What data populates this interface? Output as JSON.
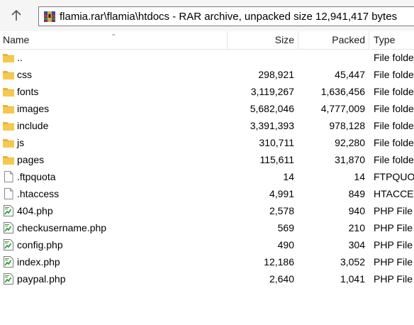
{
  "toolbar": {
    "up_icon": "arrow-up-icon"
  },
  "address": {
    "icon": "rar-archive-icon",
    "path": "flamia.rar\\flamia\\htdocs - RAR archive, unpacked size 12,941,417 bytes"
  },
  "columns": {
    "name": "Name",
    "size": "Size",
    "packed": "Packed",
    "type": "Type"
  },
  "files": [
    {
      "name": "..",
      "size": "",
      "packed": "",
      "type": "File folder",
      "icon": "folder-icon"
    },
    {
      "name": "css",
      "size": "298,921",
      "packed": "45,447",
      "type": "File folder",
      "icon": "folder-icon"
    },
    {
      "name": "fonts",
      "size": "3,119,267",
      "packed": "1,636,456",
      "type": "File folder",
      "icon": "folder-icon"
    },
    {
      "name": "images",
      "size": "5,682,046",
      "packed": "4,777,009",
      "type": "File folder",
      "icon": "folder-icon"
    },
    {
      "name": "include",
      "size": "3,391,393",
      "packed": "978,128",
      "type": "File folder",
      "icon": "folder-icon"
    },
    {
      "name": "js",
      "size": "310,711",
      "packed": "92,280",
      "type": "File folder",
      "icon": "folder-icon"
    },
    {
      "name": "pages",
      "size": "115,611",
      "packed": "31,870",
      "type": "File folder",
      "icon": "folder-icon"
    },
    {
      "name": ".ftpquota",
      "size": "14",
      "packed": "14",
      "type": "FTPQUOTA File",
      "icon": "blank-file-icon"
    },
    {
      "name": ".htaccess",
      "size": "4,991",
      "packed": "849",
      "type": "HTACCESS File",
      "icon": "blank-file-icon"
    },
    {
      "name": "404.php",
      "size": "2,578",
      "packed": "940",
      "type": "PHP File",
      "icon": "php-file-icon"
    },
    {
      "name": "checkusername.php",
      "size": "569",
      "packed": "210",
      "type": "PHP File",
      "icon": "php-file-icon"
    },
    {
      "name": "config.php",
      "size": "490",
      "packed": "304",
      "type": "PHP File",
      "icon": "php-file-icon"
    },
    {
      "name": "index.php",
      "size": "12,186",
      "packed": "3,052",
      "type": "PHP File",
      "icon": "php-file-icon"
    },
    {
      "name": "paypal.php",
      "size": "2,640",
      "packed": "1,041",
      "type": "PHP File",
      "icon": "php-file-icon"
    }
  ]
}
